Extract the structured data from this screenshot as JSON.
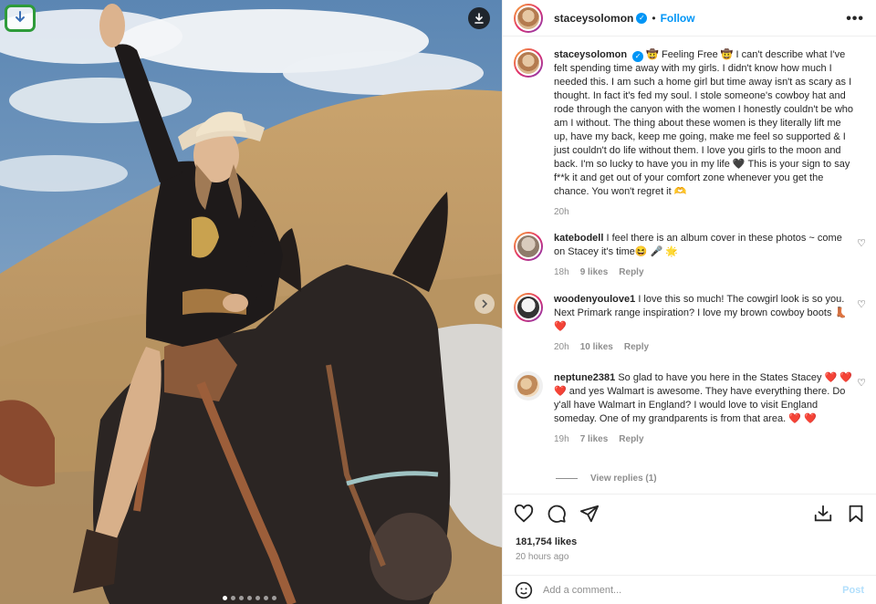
{
  "header": {
    "username": "staceysolomon",
    "follow_label": "Follow",
    "more_icon": "more-horizontal-icon"
  },
  "caption": {
    "username": "staceysolomon",
    "text": "🤠 Feeling Free 🤠 I can't describe what I've felt spending time away with my girls. I didn't know how much I needed this. I am such a home girl but time away isn't as scary as I thought. In fact it's fed my soul. I stole someone's cowboy hat and rode through the canyon with the women I honestly couldn't be who am I without. The thing about these women is they literally lift me up, have my back, keep me going, make me feel so supported & I just couldn't do life without them. I love you girls to the moon and back. I'm so lucky to have you in my life 🖤 This is your sign to say f**k it and get out of your comfort zone whenever you get the chance. You won't regret it 🫶",
    "time": "20h"
  },
  "comments": [
    {
      "username": "katebodell",
      "text": "I feel there is an album cover in these photos ~ come on Stacey it's time😆 🎤 🌟",
      "time": "18h",
      "likes": "9 likes",
      "reply_label": "Reply"
    },
    {
      "username": "woodenyoulove1",
      "text": "I love this so much! The cowgirl look is so you. Next Primark range inspiration? I love my brown cowboy boots 👢 ❤️",
      "time": "20h",
      "likes": "10 likes",
      "reply_label": "Reply"
    },
    {
      "username": "neptune2381",
      "text": "So glad to have you here in the States Stacey ❤️ ❤️ ❤️ and yes Walmart is awesome. They have everything there. Do y'all have Walmart in England? I would love to visit England someday. One of my grandparents is from that area. ❤️ ❤️",
      "time": "19h",
      "likes": "7 likes",
      "reply_label": "Reply",
      "view_replies": "View replies (1)"
    }
  ],
  "actions": {
    "likes": "181,754 likes",
    "posted": "20 hours ago"
  },
  "add_comment": {
    "placeholder": "Add a comment...",
    "post_label": "Post"
  },
  "colors": {
    "accent": "#0095f6",
    "heart": "#ed4956",
    "muted": "#8e8e8e",
    "extension_border": "#2e9b3a"
  },
  "carousel": {
    "slides": 7,
    "active_index": 0
  }
}
